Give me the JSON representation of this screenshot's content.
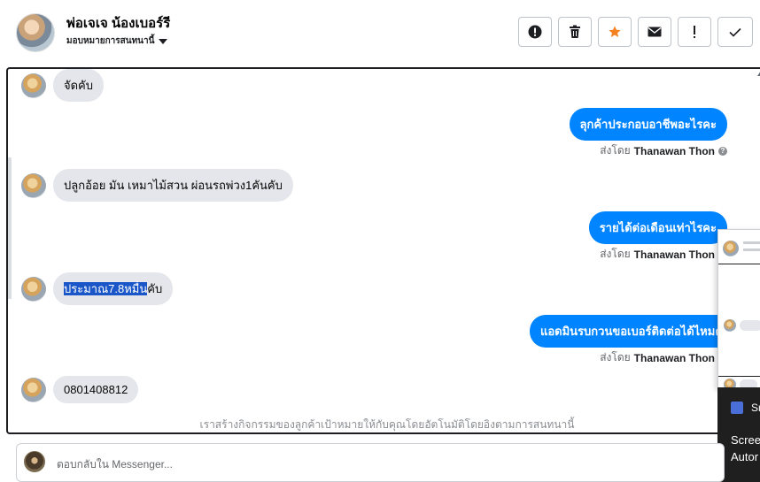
{
  "header": {
    "name": "พ่อเจเจ น้องเบอร์รี",
    "assign_label": "มอบหมายการสนทนานี้",
    "actions": [
      {
        "icon": "exclamation-circle-icon",
        "glyph": "●"
      },
      {
        "icon": "trash-icon",
        "glyph": "🗑"
      },
      {
        "icon": "star-icon",
        "glyph": "★"
      },
      {
        "icon": "envelope-icon",
        "glyph": "✉"
      },
      {
        "icon": "exclamation-icon",
        "glyph": "!"
      },
      {
        "icon": "checkmark-icon",
        "glyph": "✓"
      }
    ]
  },
  "messages": [
    {
      "dir": "in",
      "text": "จัดคับ"
    },
    {
      "dir": "out",
      "text": "ลุกค้าประกอบอาชีพอะไรคะ",
      "sent_by_label": "ส่งโดย",
      "sender": "Thanawan Thon"
    },
    {
      "dir": "in",
      "text": "ปลูกอ้อย มัน เหมาไม้สวน ผ่อนรถพ่วง1คันคับ"
    },
    {
      "dir": "out",
      "text": "รายได้ต่อเดือนเท่าไรคะ",
      "sent_by_label": "ส่งโดย",
      "sender": "Thanawan Thon"
    },
    {
      "dir": "in",
      "text_highlight": "ประมาณ7.8หมื่น",
      "text_rest": "คับ"
    },
    {
      "dir": "out",
      "text": "แอดมินรบกวนขอเบอร์ติดต่อได้ไหมคะ",
      "sent_by_label": "ส่งโดย",
      "sender": "Thanawan Thon"
    },
    {
      "dir": "in",
      "text": "0801408812"
    }
  ],
  "footer_note": "เราสร้างกิจกรรมของลูกค้าเป้าหมายให้กับคุณโดยอัตโนมัติโดยอิงตามการสนทนานี้",
  "toast": {
    "app": "Sn",
    "line1": "Scree",
    "line2": "Autor"
  },
  "composer": {
    "placeholder": "ตอบกลับใน Messenger..."
  },
  "colors": {
    "outgoing_bubble": "#0084ff",
    "incoming_bubble": "#e4e6eb",
    "highlight": "#1a56c8",
    "star": "#f5821f"
  }
}
